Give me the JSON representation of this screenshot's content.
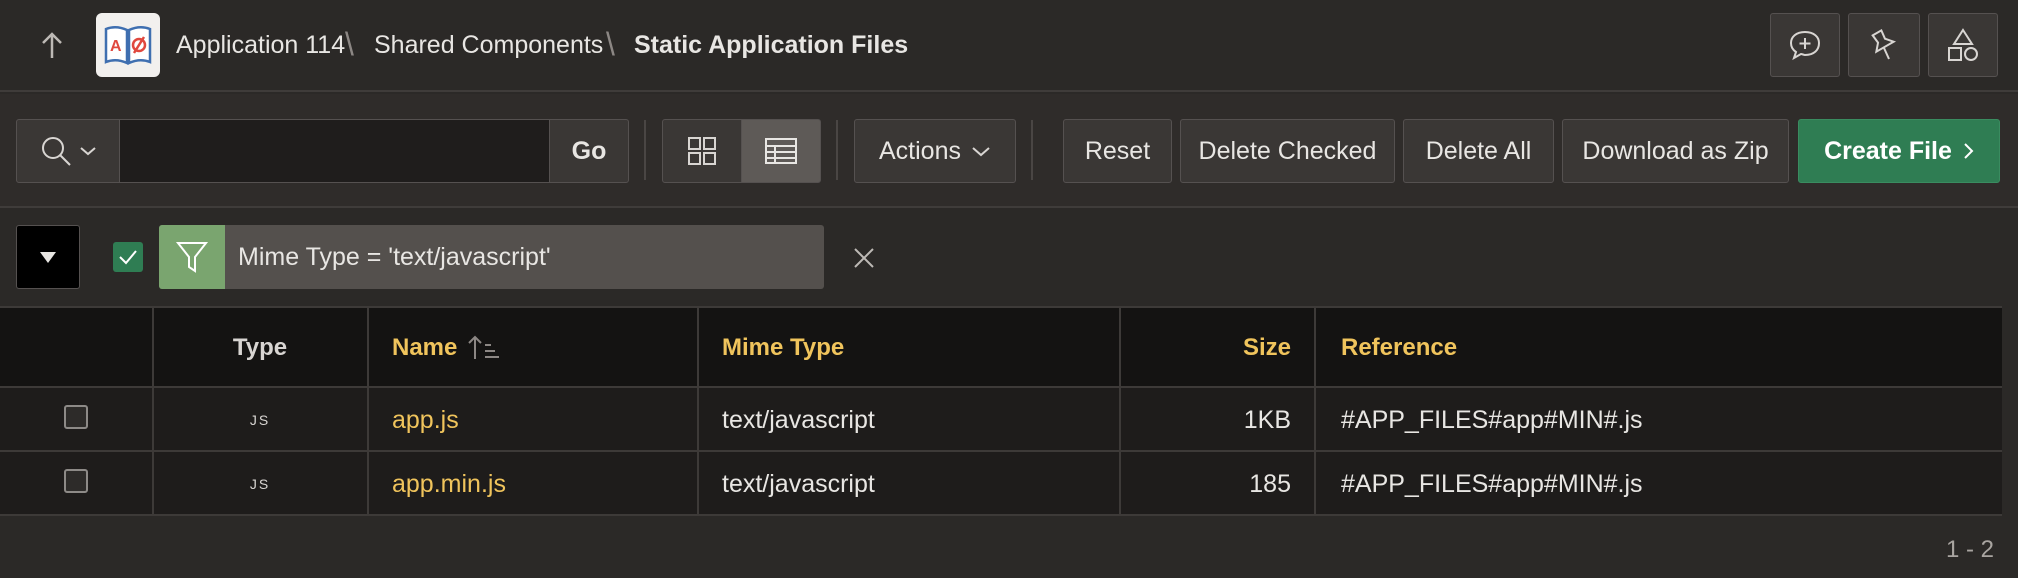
{
  "header": {
    "app_name": "Application 114",
    "breadcrumb_1": "Shared Components",
    "breadcrumb_current": "Static Application Files",
    "separator": "\\"
  },
  "toolbar": {
    "go_label": "Go",
    "search_value": "",
    "actions_label": "Actions",
    "reset_label": "Reset",
    "delete_checked_label": "Delete Checked",
    "delete_all_label": "Delete All",
    "download_zip_label": "Download as Zip",
    "create_file_label": "Create File"
  },
  "filter": {
    "text": "Mime Type = 'text/javascript'",
    "enabled": true
  },
  "table": {
    "columns": {
      "type": "Type",
      "name": "Name",
      "mime": "Mime Type",
      "size": "Size",
      "reference": "Reference"
    },
    "rows": [
      {
        "type": "JS",
        "name": "app.js",
        "mime": "text/javascript",
        "size": "1KB",
        "reference": "#APP_FILES#app#MIN#.js"
      },
      {
        "type": "JS",
        "name": "app.min.js",
        "mime": "text/javascript",
        "size": "185",
        "reference": "#APP_FILES#app#MIN#.js"
      }
    ]
  },
  "pagination": {
    "range": "1 - 2"
  },
  "colors": {
    "accent_yellow": "#f0c45c",
    "create_green": "#2f7d53",
    "filter_green": "#7aa56f"
  }
}
